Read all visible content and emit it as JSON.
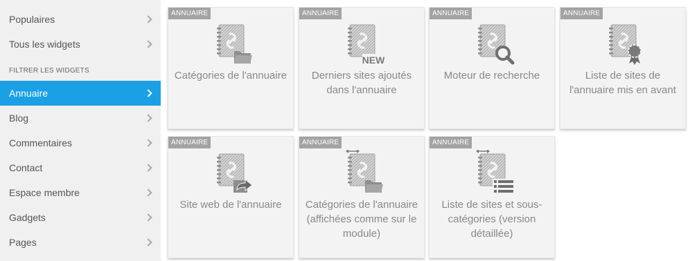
{
  "sidebar": {
    "top_items": [
      {
        "label": "Populaires"
      },
      {
        "label": "Tous les widgets"
      }
    ],
    "section_title": "FILTRER LES WIDGETS",
    "filters": [
      {
        "label": "Annuaire",
        "active": true
      },
      {
        "label": "Blog"
      },
      {
        "label": "Commentaires"
      },
      {
        "label": "Contact"
      },
      {
        "label": "Espace membre"
      },
      {
        "label": "Gadgets"
      },
      {
        "label": "Pages"
      }
    ]
  },
  "widgets": [
    {
      "badge": "ANNUAIRE",
      "label": "Catégories de l'annuaire",
      "icon": "directory-folder-icon"
    },
    {
      "badge": "ANNUAIRE",
      "label": "Derniers sites ajoutés dans l'annuaire",
      "icon": "directory-new-icon",
      "icon_text": "NEW"
    },
    {
      "badge": "ANNUAIRE",
      "label": "Moteur de recherche",
      "icon": "directory-search-icon"
    },
    {
      "badge": "ANNUAIRE",
      "label": "Liste de sites de l'annuaire mis en avant",
      "icon": "directory-featured-icon"
    },
    {
      "badge": "ANNUAIRE",
      "label": "Site web de l'annuaire",
      "icon": "directory-share-icon"
    },
    {
      "badge": "ANNUAIRE",
      "label": "Catégories de l'annuaire (affichées comme sur le module)",
      "icon": "directory-folder-expand-icon"
    },
    {
      "badge": "ANNUAIRE",
      "label": "Liste de sites et sous-catégories (version détaillée)",
      "icon": "directory-list-expand-icon"
    }
  ],
  "colors": {
    "accent": "#1ba0e6",
    "badge": "#a3a3a3",
    "icon": "#9a9a9a"
  }
}
